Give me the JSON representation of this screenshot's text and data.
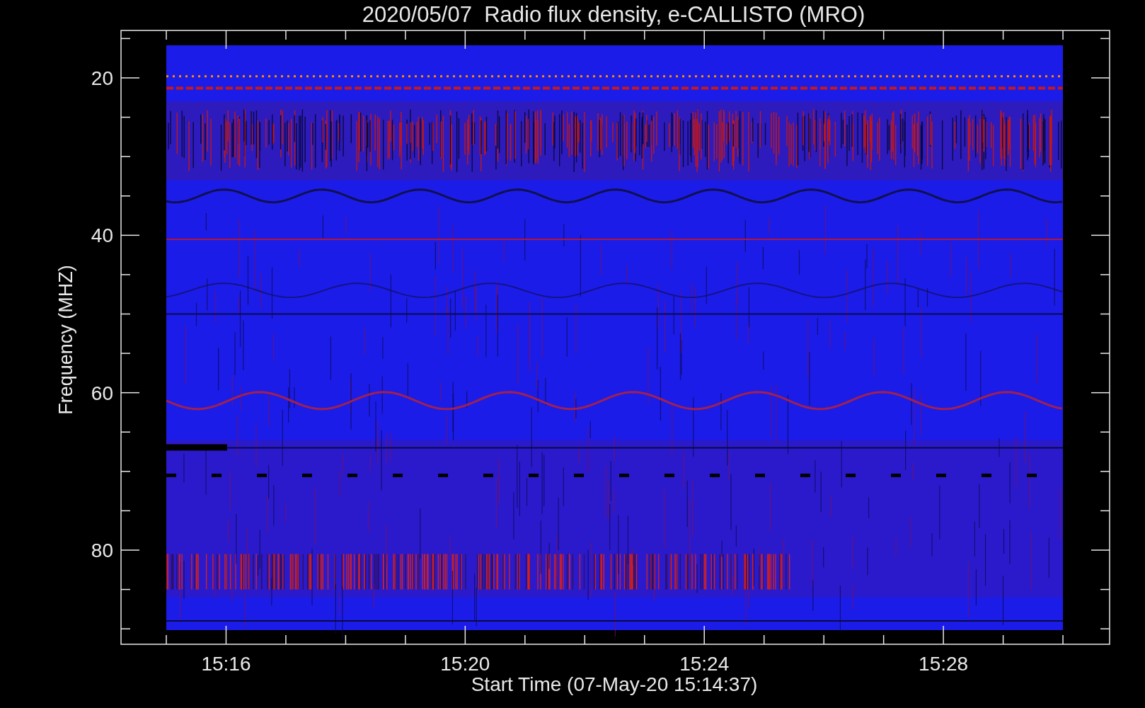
{
  "title": "2020/05/07  Radio flux density, e-CALLISTO (MRO)",
  "y_axis": {
    "label": "Frequency (MHZ)",
    "ticks": [
      "20",
      "40",
      "60",
      "80"
    ]
  },
  "x_axis": {
    "label": "Start Time (07-May-20 15:14:37)",
    "ticks": [
      "15:16",
      "15:20",
      "15:24",
      "15:28"
    ]
  }
}
